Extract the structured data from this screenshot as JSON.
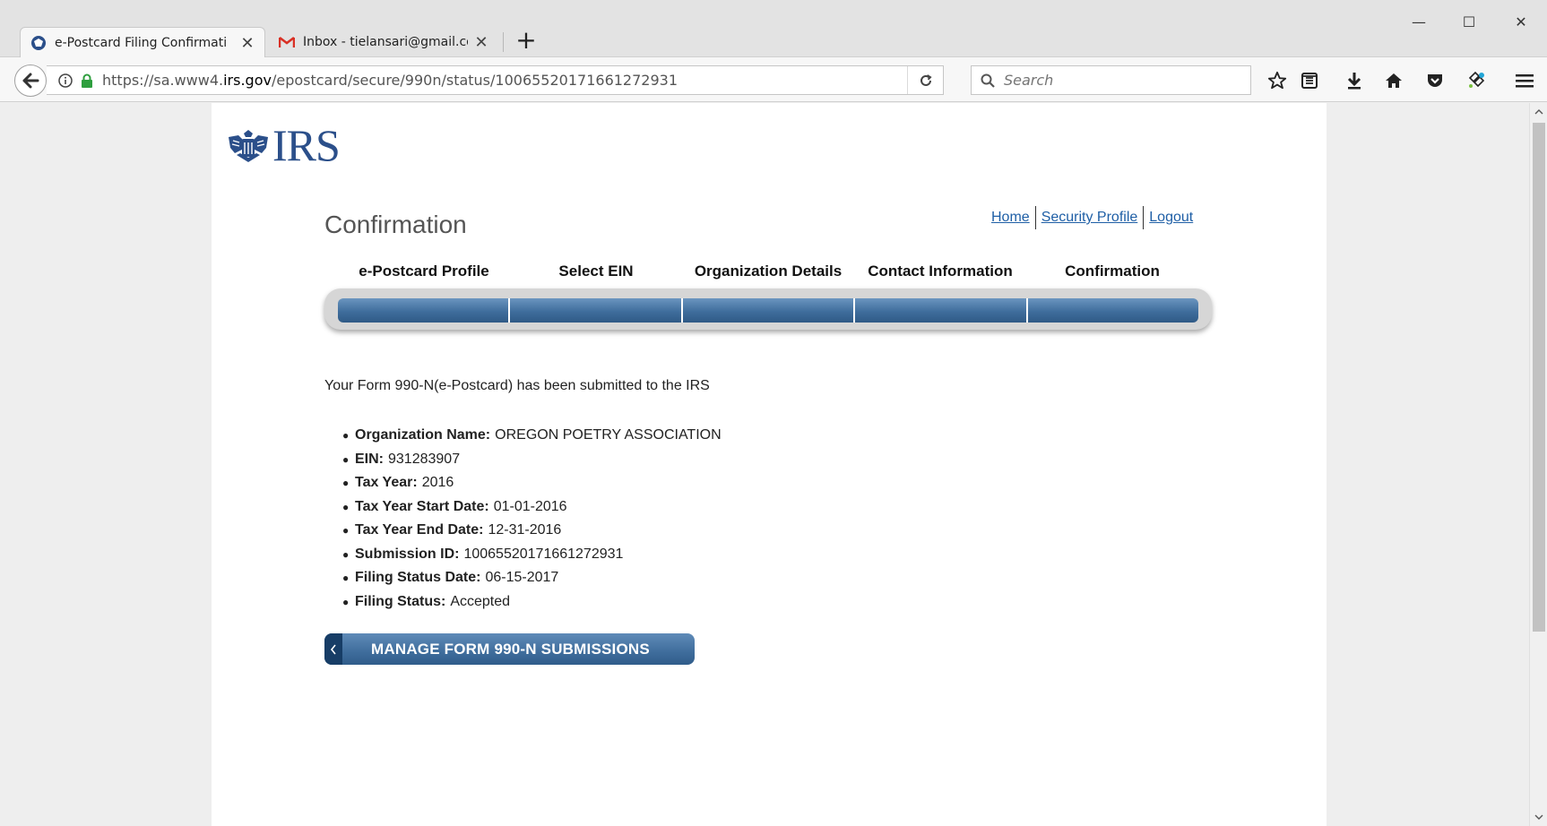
{
  "browser": {
    "tabs": [
      {
        "title": "e-Postcard Filing Confirmati",
        "favicon": "irs-eagle-icon",
        "active": true
      },
      {
        "title": "Inbox - tielansari@gmail.con",
        "favicon": "gmail-icon",
        "active": false
      }
    ],
    "new_tab_label": "+",
    "window_controls": {
      "minimize": "—",
      "maximize": "☐",
      "close": "✕"
    },
    "url_prefix": "https://sa.www4.",
    "url_host": "irs.gov",
    "url_path": "/epostcard/secure/990n/status/10065520171661272931",
    "search_placeholder": "Search"
  },
  "page": {
    "logo_text": "IRS",
    "title": "Confirmation",
    "top_links": {
      "home": "Home",
      "security": "Security Profile",
      "logout": "Logout"
    },
    "steps": [
      "e-Postcard Profile",
      "Select EIN",
      "Organization Details",
      "Contact Information",
      "Confirmation"
    ],
    "submitted_message": "Your Form 990-N(e-Postcard) has been submitted to the IRS",
    "details": [
      {
        "label": "Organization Name:",
        "value": "OREGON POETRY ASSOCIATION"
      },
      {
        "label": "EIN:",
        "value": "931283907"
      },
      {
        "label": "Tax Year:",
        "value": "2016"
      },
      {
        "label": "Tax Year Start Date:",
        "value": "01-01-2016"
      },
      {
        "label": "Tax Year End Date:",
        "value": "12-31-2016"
      },
      {
        "label": "Submission ID:",
        "value": "10065520171661272931"
      },
      {
        "label": "Filing Status Date:",
        "value": "06-15-2017"
      },
      {
        "label": "Filing Status:",
        "value": "Accepted"
      }
    ],
    "manage_button": "MANAGE FORM 990-N SUBMISSIONS"
  },
  "colors": {
    "accent": "#3f6d9c",
    "link": "#1f5fa6",
    "logo": "#2b4f8a"
  }
}
